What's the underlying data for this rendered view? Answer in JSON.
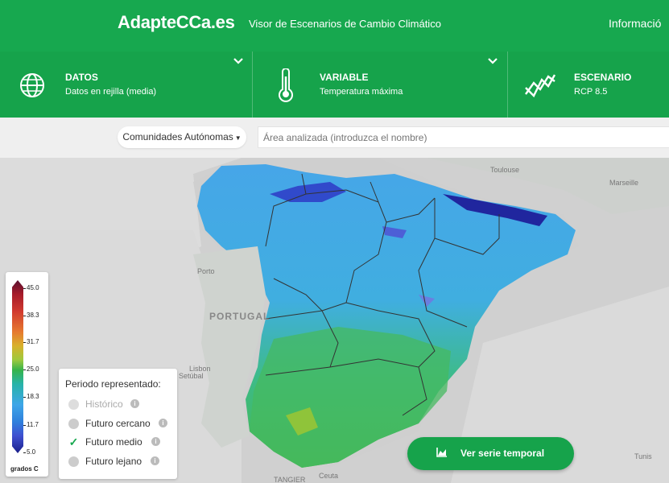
{
  "header": {
    "logo": "AdapteCCa.es",
    "subtitle": "Visor de Escenarios de Cambio Climático",
    "info_link": "Informació"
  },
  "selectors": [
    {
      "title": "DATOS",
      "value": "Datos en rejilla (media)",
      "icon": "globe-icon"
    },
    {
      "title": "VARIABLE",
      "value": "Temperatura máxima",
      "icon": "thermometer-icon"
    },
    {
      "title": "ESCENARIO",
      "value": "RCP 8.5",
      "icon": "trend-chart-icon"
    }
  ],
  "filters": {
    "region_select": "Comunidades Autónomas",
    "area_placeholder": "Área analizada (introduzca el nombre)"
  },
  "map": {
    "labels": {
      "toulouse": "Toulouse",
      "marseille": "Marseille",
      "porto": "Porto",
      "portugal": "PORTUGAL",
      "lisbon": "Lisbon",
      "setubal": "Setúbal",
      "tangier": "TANGIER",
      "ceuta": "Ceuta",
      "tunis": "Tunis"
    },
    "colors": {
      "land": "#c9cec9",
      "sea": "#dcdcdc"
    }
  },
  "legend": {
    "ticks": [
      "45.0",
      "38.3",
      "31.7",
      "25.0",
      "18.3",
      "11.7",
      "5.0"
    ],
    "unit": "grados C"
  },
  "period": {
    "title": "Periodo representado:",
    "options": [
      {
        "label": "Histórico",
        "state": "disabled"
      },
      {
        "label": "Futuro cercano",
        "state": "unchecked"
      },
      {
        "label": "Futuro medio",
        "state": "checked"
      },
      {
        "label": "Futuro lejano",
        "state": "unchecked"
      }
    ]
  },
  "serie_button": "Ver serie temporal"
}
